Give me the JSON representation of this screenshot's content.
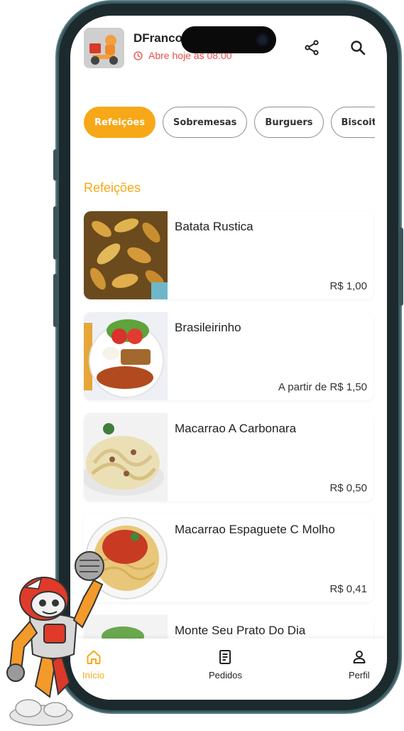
{
  "header": {
    "store_name": "DFranco",
    "status_text": "Abre hoje as 08:00",
    "share_icon": "share-icon",
    "search_icon": "search-icon"
  },
  "categories": [
    {
      "label": "Refeições",
      "active": true
    },
    {
      "label": "Sobremesas",
      "active": false
    },
    {
      "label": "Burguers",
      "active": false
    },
    {
      "label": "Biscoitos",
      "active": false
    }
  ],
  "section_title": "Refeições",
  "products": [
    {
      "name": "Batata Rustica",
      "price": "R$ 1,00"
    },
    {
      "name": "Brasileirinho",
      "price": "A partir de R$ 1,50"
    },
    {
      "name": "Macarrao A Carbonara",
      "price": "R$ 0,50"
    },
    {
      "name": "Macarrao Espaguete C Molho",
      "price": "R$ 0,41"
    },
    {
      "name": "Monte Seu Prato Do Dia",
      "price": ""
    }
  ],
  "nav": {
    "home": "Início",
    "orders": "Pedidos",
    "profile": "Perfil"
  },
  "colors": {
    "accent": "#f7a818",
    "status": "#e8504a"
  }
}
